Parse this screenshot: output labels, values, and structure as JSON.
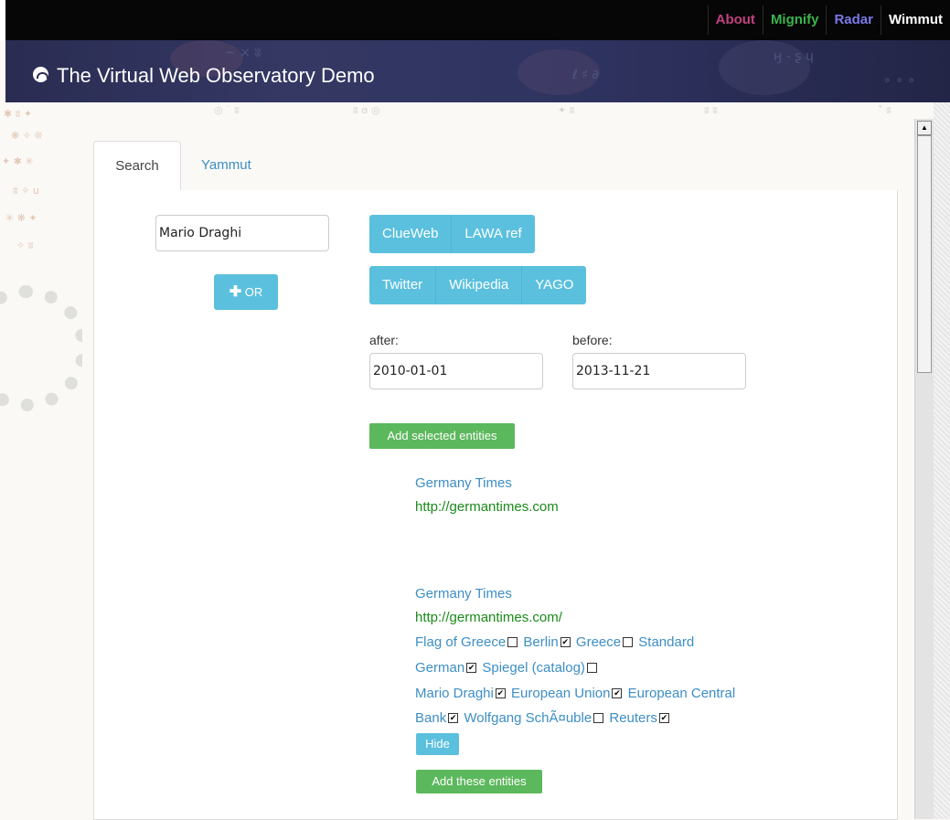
{
  "topnav": {
    "items": [
      {
        "label": "About",
        "color": "#c0417f"
      },
      {
        "label": "Mignify",
        "color": "#3cb44a"
      },
      {
        "label": "Radar",
        "color": "#7b78e8"
      },
      {
        "label": "Wimmut",
        "color": "#ffffff"
      }
    ]
  },
  "header": {
    "title": "The Virtual Web Observatory Demo"
  },
  "tabs": [
    {
      "label": "Search"
    },
    {
      "label": "Yammut"
    }
  ],
  "search": {
    "query_value": "Mario Draghi",
    "or_button": "OR",
    "sources_row1": [
      "ClueWeb",
      "LAWA ref"
    ],
    "sources_row2": [
      "Twitter",
      "Wikipedia",
      "YAGO"
    ],
    "after_label": "after:",
    "after_value": "2010-01-01",
    "before_label": "before:",
    "before_value": "2013-11-21",
    "add_selected_button": "Add selected entities"
  },
  "results": [
    {
      "title": "Germany Times",
      "url": "http://germantimes.com"
    },
    {
      "title": "Germany Times",
      "url": "http://germantimes.com/",
      "entity_lines": [
        [
          {
            "name": "Flag of Greece",
            "checked": false
          },
          {
            "name": "Berlin",
            "checked": true
          },
          {
            "name": "Greece",
            "checked": false
          },
          {
            "name": "Standard",
            "checked": null
          }
        ],
        [
          {
            "name": "German",
            "checked": true
          },
          {
            "name": "Spiegel (catalog)",
            "checked": false
          }
        ],
        [
          {
            "name": "Mario Draghi",
            "checked": true
          },
          {
            "name": "European Union",
            "checked": true
          },
          {
            "name": "European Central",
            "checked": null
          }
        ],
        [
          {
            "name": "Bank",
            "checked": true
          },
          {
            "name": "Wolfgang SchÃ¤uble",
            "checked": false
          },
          {
            "name": "Reuters",
            "checked": true
          }
        ]
      ],
      "hide_button": "Hide",
      "add_button": "Add these entities"
    }
  ]
}
